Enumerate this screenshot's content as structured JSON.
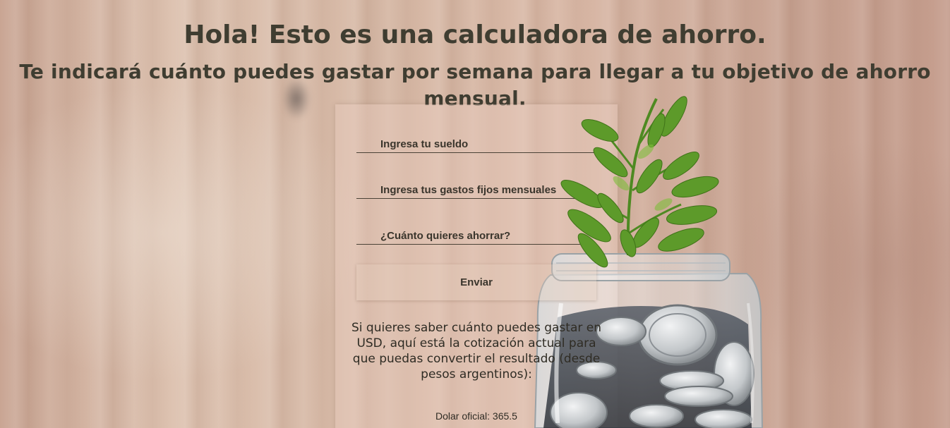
{
  "header": {
    "title": "Hola! Esto es una calculadora de ahorro.",
    "subtitle": "Te indicará cuánto puedes gastar por semana para llegar a tu objetivo de ahorro mensual."
  },
  "form": {
    "salary_label": "Ingresa tu sueldo",
    "expenses_label": "Ingresa tus gastos fijos mensuales",
    "savings_label": "¿Cuánto quieres ahorrar?",
    "submit_label": "Enviar"
  },
  "info": {
    "text": "Si quieres saber cuánto puedes gastar en USD, aquí está la cotización actual para que puedas convertir el resultado (desde pesos argentinos):",
    "dolar": "Dolar oficial: 365.5"
  },
  "colors": {
    "text": "#3d3b33",
    "background": "#d9b9a6",
    "leaf": "#5d9a2a",
    "coin": "#c8ccd0"
  }
}
